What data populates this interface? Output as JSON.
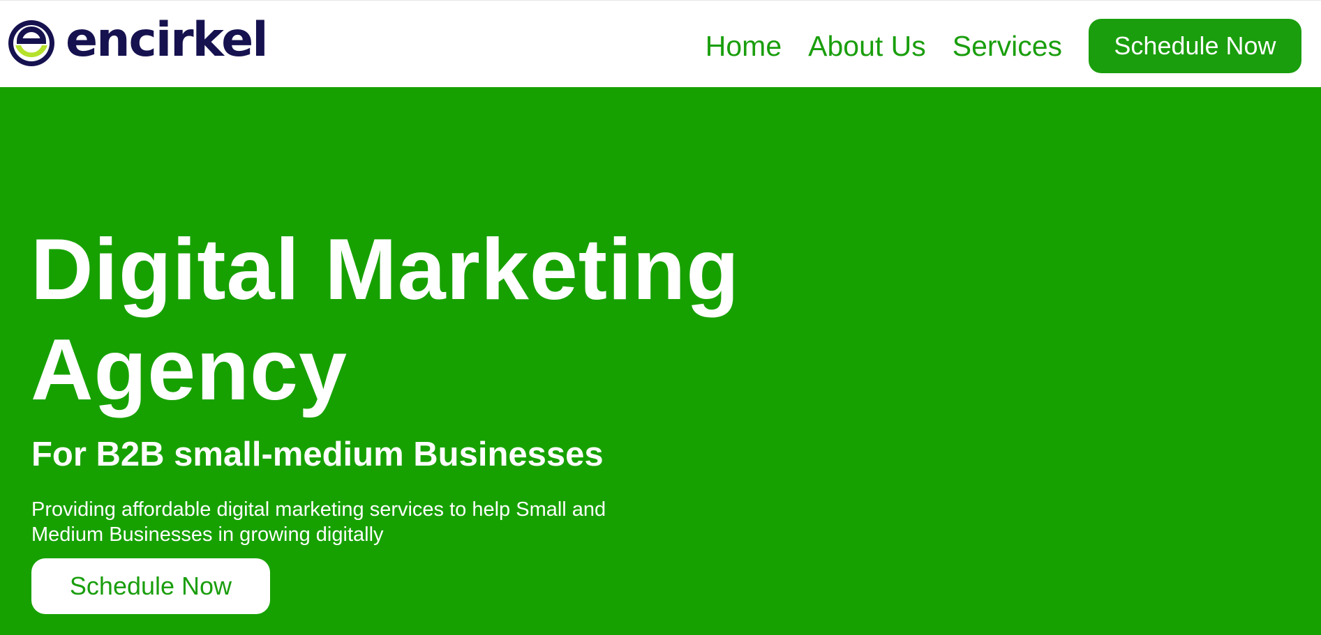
{
  "header": {
    "logo": {
      "wordmark": "encirkel",
      "icon": "encirkel-logo-icon",
      "wordmark_color": "#16124f",
      "mark_accent_color": "#b6e12d"
    },
    "nav": {
      "items": [
        {
          "label": "Home"
        },
        {
          "label": "About Us"
        },
        {
          "label": "Services"
        }
      ],
      "cta_label": "Schedule Now"
    }
  },
  "hero": {
    "title": "Digital Marketing Agency",
    "subtitle": "For B2B small-medium Businesses",
    "description": "Providing affordable digital marketing services to help Small and Medium Businesses in growing digitally",
    "cta_label": "Schedule Now"
  },
  "colors": {
    "brand_green": "#1a9e0d",
    "hero_background": "#17a100",
    "text_on_green": "#ffffff"
  }
}
